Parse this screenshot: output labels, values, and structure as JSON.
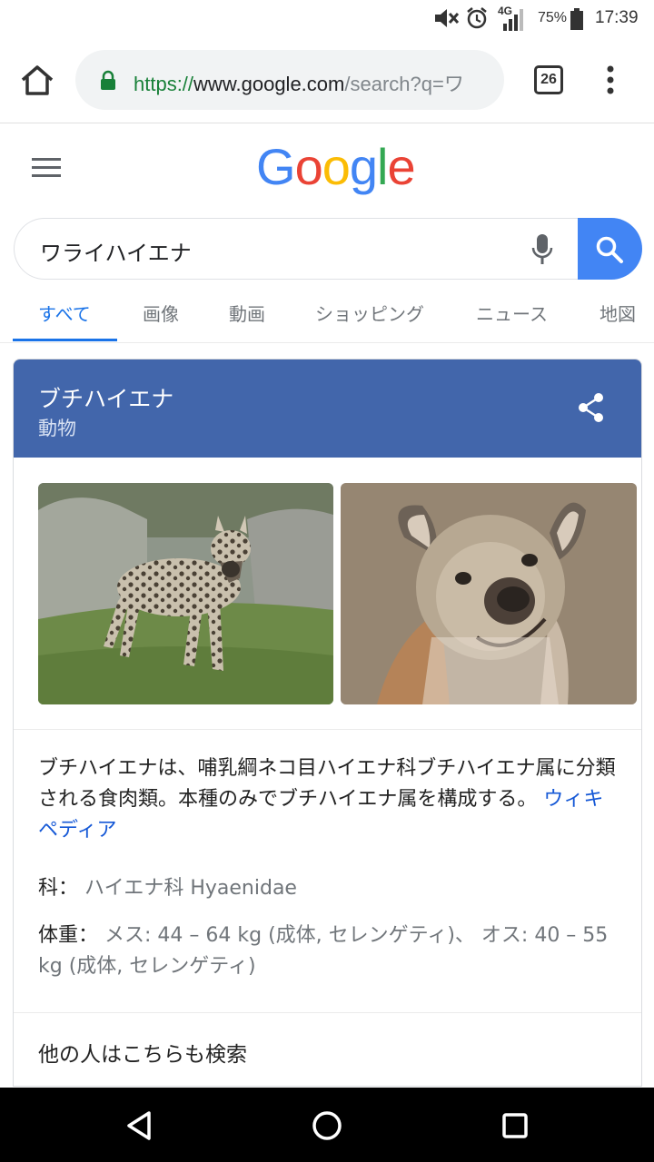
{
  "status_bar": {
    "network": "4G",
    "battery": "75%",
    "time": "17:39"
  },
  "browser": {
    "url_scheme": "https://",
    "url_host": "www.google.com",
    "url_path": "/search?q=ワ",
    "tab_count": "26"
  },
  "google": {
    "logo_letters": [
      "G",
      "o",
      "o",
      "g",
      "l",
      "e"
    ],
    "logo_colors": [
      "#4285f4",
      "#ea4335",
      "#fbbc05",
      "#4285f4",
      "#34a853",
      "#ea4335"
    ],
    "search_query": "ワライハイエナ"
  },
  "tabs": [
    "すべて",
    "画像",
    "動画",
    "ショッピング",
    "ニュース",
    "地図"
  ],
  "active_tab": "すべて",
  "knowledge_panel": {
    "header_color": "#4266ab",
    "title": "ブチハイエナ",
    "subtitle": "動物",
    "description": "ブチハイエナは、哺乳綱ネコ目ハイエナ科ブチハイエナ属に分類される食肉類。本種のみでブチハイエナ属を構成する。",
    "source_link": "ウィキペディア",
    "facts": [
      {
        "label": "科：",
        "value": "ハイエナ科 Hyaenidae"
      },
      {
        "label": "体重：",
        "value": "メス: 44 – 64 kg (成体, セレンゲティ)、 オス: 40 – 55 kg (成体, セレンゲティ)"
      }
    ],
    "related_heading": "他の人はこちらも検索"
  }
}
